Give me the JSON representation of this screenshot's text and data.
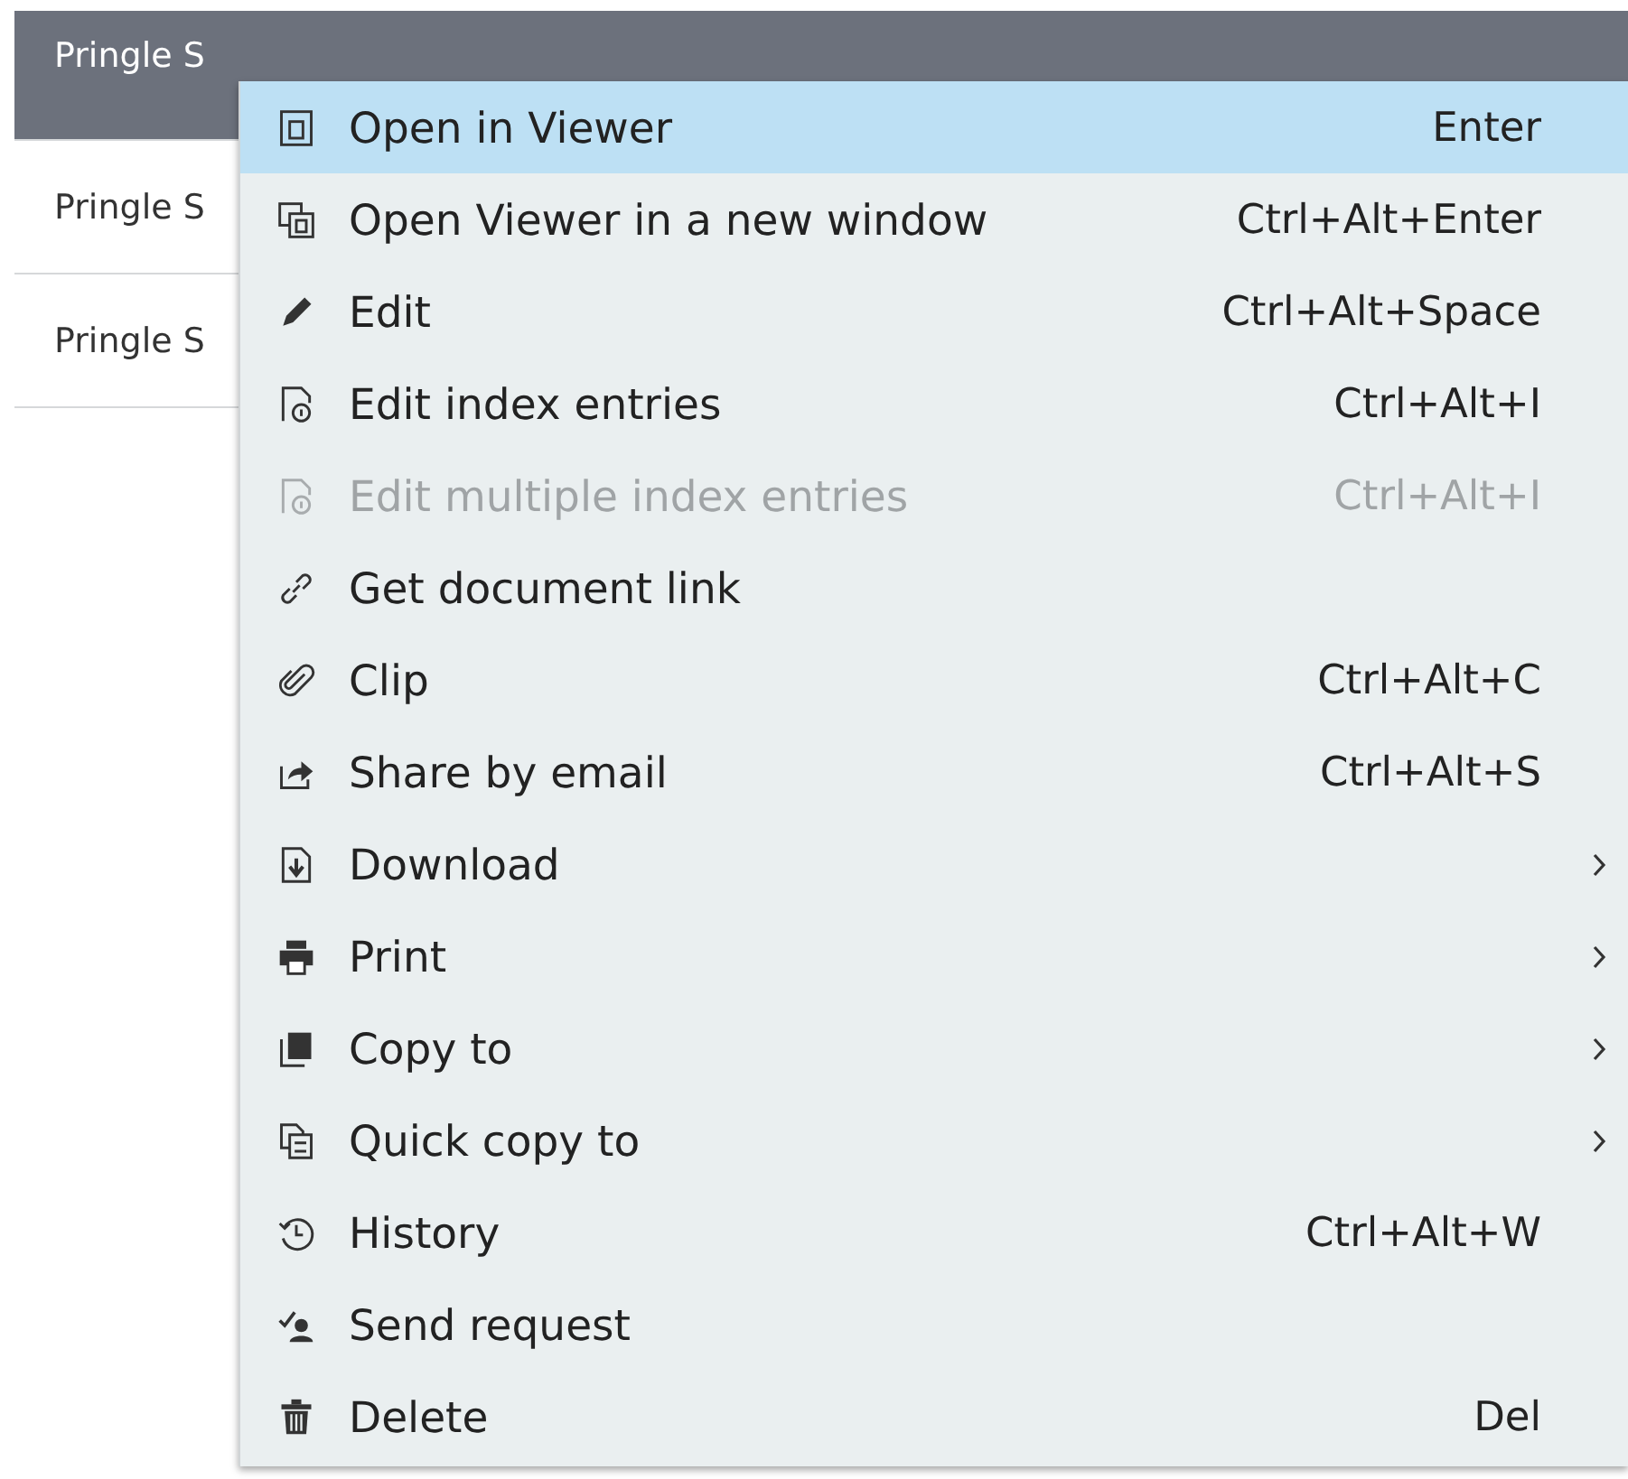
{
  "table": {
    "rows": [
      {
        "cell": "Pringle S",
        "selected": true
      },
      {
        "cell": "Pringle S",
        "selected": false
      },
      {
        "cell": "Pringle S",
        "selected": false
      }
    ]
  },
  "context_menu": {
    "items": [
      {
        "label": "Open in Viewer",
        "shortcut": "Enter",
        "selected": true,
        "disabled": false,
        "submenu": false
      },
      {
        "label": "Open Viewer in a new window",
        "shortcut": "Ctrl+Alt+Enter",
        "selected": false,
        "disabled": false,
        "submenu": false
      },
      {
        "label": "Edit",
        "shortcut": "Ctrl+Alt+Space",
        "selected": false,
        "disabled": false,
        "submenu": false
      },
      {
        "label": "Edit index entries",
        "shortcut": "Ctrl+Alt+I",
        "selected": false,
        "disabled": false,
        "submenu": false
      },
      {
        "label": "Edit multiple index entries",
        "shortcut": "Ctrl+Alt+I",
        "selected": false,
        "disabled": true,
        "submenu": false
      },
      {
        "label": "Get document link",
        "selected": false,
        "disabled": false,
        "submenu": false
      },
      {
        "label": "Clip",
        "shortcut": "Ctrl+Alt+C",
        "selected": false,
        "disabled": false,
        "submenu": false
      },
      {
        "label": "Share by email",
        "shortcut": "Ctrl+Alt+S",
        "selected": false,
        "disabled": false,
        "submenu": false
      },
      {
        "label": "Download",
        "selected": false,
        "disabled": false,
        "submenu": true
      },
      {
        "label": "Print",
        "selected": false,
        "disabled": false,
        "submenu": true
      },
      {
        "label": "Copy to",
        "selected": false,
        "disabled": false,
        "submenu": true
      },
      {
        "label": "Quick copy to",
        "selected": false,
        "disabled": false,
        "submenu": true
      },
      {
        "label": "History",
        "shortcut": "Ctrl+Alt+W",
        "selected": false,
        "disabled": false,
        "submenu": false
      },
      {
        "label": "Send request",
        "selected": false,
        "disabled": false,
        "submenu": false
      },
      {
        "label": "Delete",
        "shortcut": "Del",
        "selected": false,
        "disabled": false,
        "submenu": false
      }
    ]
  }
}
